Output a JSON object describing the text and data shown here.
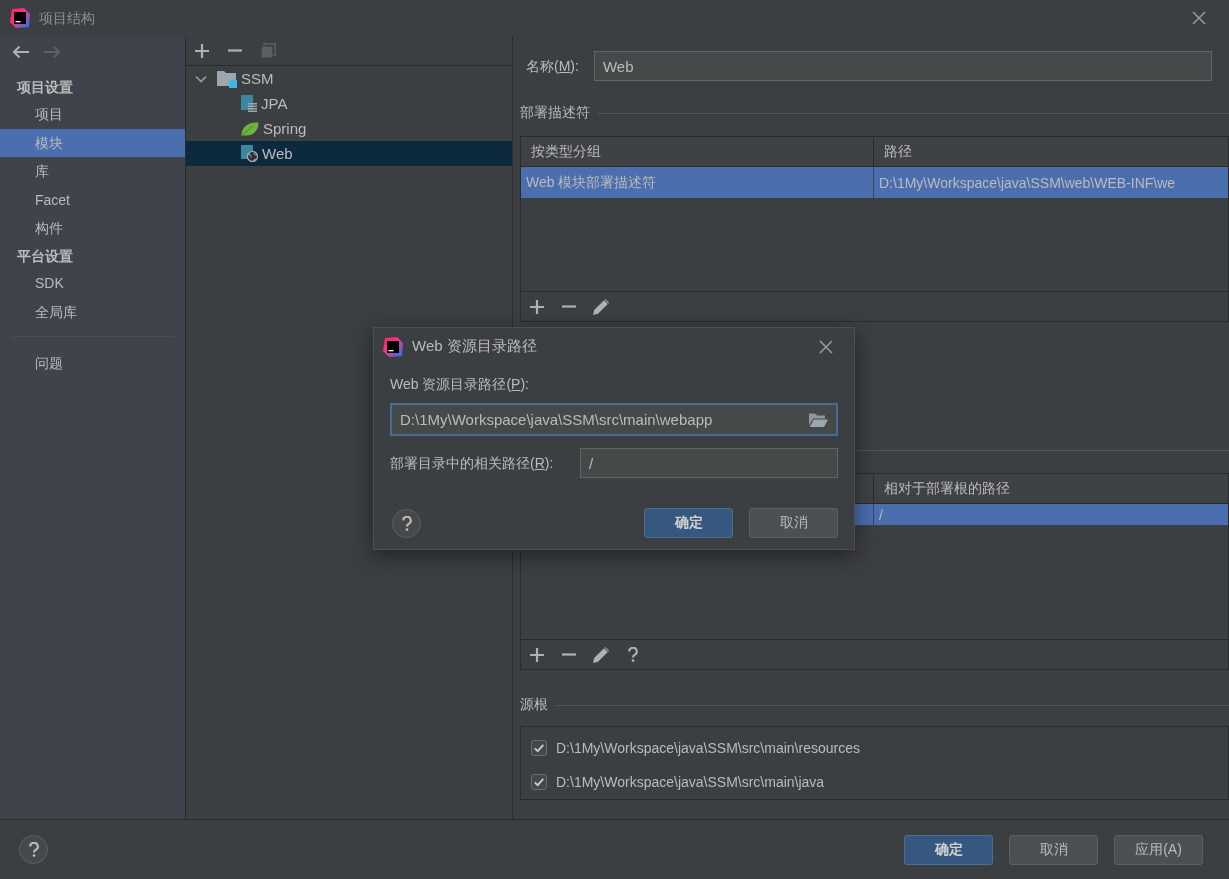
{
  "window": {
    "title": "项目结构"
  },
  "sidebar": {
    "nav": [
      {
        "kind": "back",
        "disabled": false
      },
      {
        "kind": "forward",
        "disabled": true
      }
    ],
    "groups": [
      {
        "heading": "项目设置",
        "items": [
          {
            "label": "项目",
            "selected": false
          },
          {
            "label": "模块",
            "selected": true
          },
          {
            "label": "库",
            "selected": false
          },
          {
            "label": "Facet",
            "selected": false
          },
          {
            "label": "构件",
            "selected": false
          }
        ]
      },
      {
        "heading": "平台设置",
        "items": [
          {
            "label": "SDK",
            "selected": false
          },
          {
            "label": "全局库",
            "selected": false
          }
        ]
      },
      {
        "items": [
          {
            "label": "问题",
            "selected": false
          }
        ]
      }
    ]
  },
  "module_tree": {
    "toolbar": [
      {
        "kind": "add",
        "disabled": false
      },
      {
        "kind": "remove",
        "disabled": false
      },
      {
        "kind": "copy",
        "disabled": true
      }
    ],
    "nodes": [
      {
        "label": "SSM",
        "kind": "module",
        "expanded": true,
        "selected": false,
        "children": [
          {
            "label": "JPA",
            "kind": "jpa",
            "selected": false
          },
          {
            "label": "Spring",
            "kind": "spring",
            "selected": false
          },
          {
            "label": "Web",
            "kind": "web",
            "selected": true
          }
        ]
      }
    ]
  },
  "details": {
    "name": {
      "label": {
        "before": "名称(",
        "mnemonic": "M",
        "after": "):"
      },
      "value": "Web"
    },
    "deployment_descriptors": {
      "title": "部署描述符",
      "columns": [
        "按类型分组",
        "路径"
      ],
      "rows": [
        {
          "cells": [
            "Web 模块部署描述符",
            "D:\\1My\\Workspace\\java\\SSM\\web\\WEB-INF\\we"
          ],
          "selected": true
        }
      ],
      "toolbar": [
        {
          "kind": "add"
        },
        {
          "kind": "remove"
        },
        {
          "kind": "edit"
        }
      ]
    },
    "path_table": {
      "columns": [
        "相对于部署根的路径"
      ],
      "rows": [
        {
          "cells": [
            "/"
          ],
          "selected": true
        }
      ],
      "toolbar": [
        {
          "kind": "add"
        },
        {
          "kind": "remove"
        },
        {
          "kind": "edit"
        },
        {
          "kind": "help"
        }
      ]
    },
    "source_roots": {
      "title": "源根",
      "items": [
        {
          "path": "D:\\1My\\Workspace\\java\\SSM\\src\\main\\resources",
          "checked": true
        },
        {
          "path": "D:\\1My\\Workspace\\java\\SSM\\src\\main\\java",
          "checked": true
        }
      ]
    }
  },
  "footer": {
    "buttons": [
      {
        "label": "确定",
        "default": true
      },
      {
        "label": "取消",
        "default": false
      },
      {
        "label": "应用(A)",
        "default": false
      }
    ]
  },
  "dialog": {
    "title": "Web 资源目录路径",
    "fields": [
      {
        "kind": "path",
        "label": {
          "before": "Web 资源目录路径(",
          "mnemonic": "P",
          "after": "):"
        },
        "value": "D:\\1My\\Workspace\\java\\SSM\\src\\main\\webapp",
        "focused": true
      },
      {
        "kind": "text",
        "label": {
          "before": "部署目录中的相关路径(",
          "mnemonic": "R",
          "after": "):"
        },
        "value": "/",
        "focused": false
      }
    ],
    "buttons": [
      {
        "label": "确定",
        "default": true
      },
      {
        "label": "取消",
        "default": false
      }
    ]
  }
}
